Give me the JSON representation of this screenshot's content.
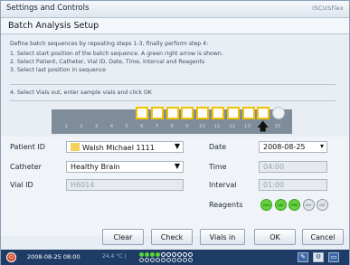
{
  "window": {
    "title": "Settings and Controls",
    "brand": "ISCUSflex"
  },
  "header": {
    "title": "Batch Analysis Setup"
  },
  "instructions": {
    "intro": "Define batch sequences by repeating steps 1-3, finally perform step 4:",
    "step1": "1. Select start position of the batch sequence. A green right arrow is shown.",
    "step2": "2. Select Patient, Catheter, Vial ID, Date, Time, Interval and Reagents",
    "step3": "3. Select last position in sequence",
    "step4": "4. Select Vials out, enter sample vials and click OK"
  },
  "tray": {
    "positions": [
      "1",
      "2",
      "3",
      "4",
      "5",
      "6",
      "7",
      "8",
      "9",
      "10",
      "11",
      "12",
      "13",
      "14",
      "15"
    ],
    "arrow": "🡅"
  },
  "form": {
    "patient_label": "Patient ID",
    "patient_value": "Walsh Michael 1111",
    "catheter_label": "Catheter",
    "catheter_value": "Healthy Brain",
    "vial_label": "Vial ID",
    "vial_value": "H6014",
    "date_label": "Date",
    "date_value": "2008-08-25",
    "time_label": "Time",
    "time_value": "04:00",
    "interval_label": "Interval",
    "interval_value": "01:00",
    "reagents_label": "Reagents",
    "reagents": [
      {
        "name": "GLU",
        "active": true
      },
      {
        "name": "LAC",
        "active": true
      },
      {
        "name": "PYR",
        "active": true
      },
      {
        "name": "GLY",
        "active": false
      },
      {
        "name": "GLT",
        "active": false
      }
    ]
  },
  "buttons": {
    "clear": "Clear",
    "check": "Check",
    "vials_in": "Vials in",
    "ok": "OK",
    "cancel": "Cancel"
  },
  "statusbar": {
    "datetime": "2008-08-25 08:00",
    "temperature": "24.4 °C",
    "separator": "|"
  }
}
